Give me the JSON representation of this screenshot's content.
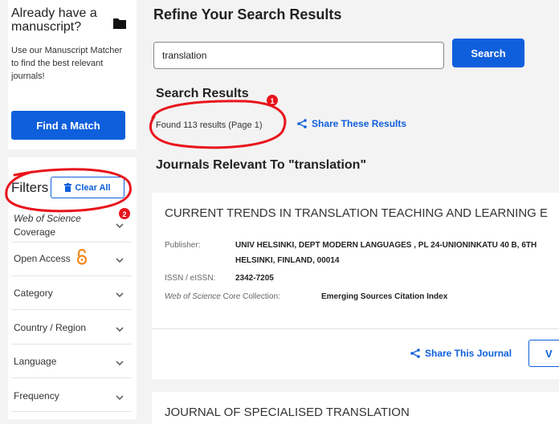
{
  "sidebar": {
    "promo": {
      "title": "Already have a manuscript?",
      "text": "Use our Manuscript Matcher to find the best relevant journals!",
      "button": "Find a Match"
    },
    "filters": {
      "title": "Filters",
      "clear_all": "Clear All",
      "items": [
        {
          "label_line1": "Web of Science",
          "label_line2": "Coverage"
        },
        {
          "label": "Open Access"
        },
        {
          "label": "Category"
        },
        {
          "label": "Country / Region"
        },
        {
          "label": "Language"
        },
        {
          "label": "Frequency"
        }
      ]
    }
  },
  "main": {
    "title": "Refine Your Search Results",
    "search": {
      "value": "translation",
      "button": "Search"
    },
    "results_heading": "Search Results",
    "results_count": "Found 113 results (Page 1)",
    "share_results": "Share These Results",
    "relevant_heading": "Journals Relevant To \"translation\"",
    "journals": [
      {
        "title": "CURRENT TRENDS IN TRANSLATION TEACHING AND LEARNING E",
        "publisher_label": "Publisher:",
        "publisher_line1": "UNIV HELSINKI, DEPT MODERN LANGUAGES , PL 24-UNIONINKATU 40 B, 6TH",
        "publisher_line2": "HELSINKI, FINLAND, 00014",
        "issn_label": "ISSN / eISSN:",
        "issn": "2342-7205",
        "collection_label_italic": "Web of Science",
        "collection_label_rest": " Core Collection:",
        "collection": "Emerging Sources Citation Index",
        "share": "Share This Journal",
        "view": "V"
      },
      {
        "title": "JOURNAL OF SPECIALISED TRANSLATION"
      }
    ]
  },
  "annotations": {
    "badge1": "1",
    "badge2": "2"
  },
  "colors": {
    "accent": "#0f5fdc",
    "annotation": "#e8141c",
    "open_access": "#f28a1e"
  }
}
